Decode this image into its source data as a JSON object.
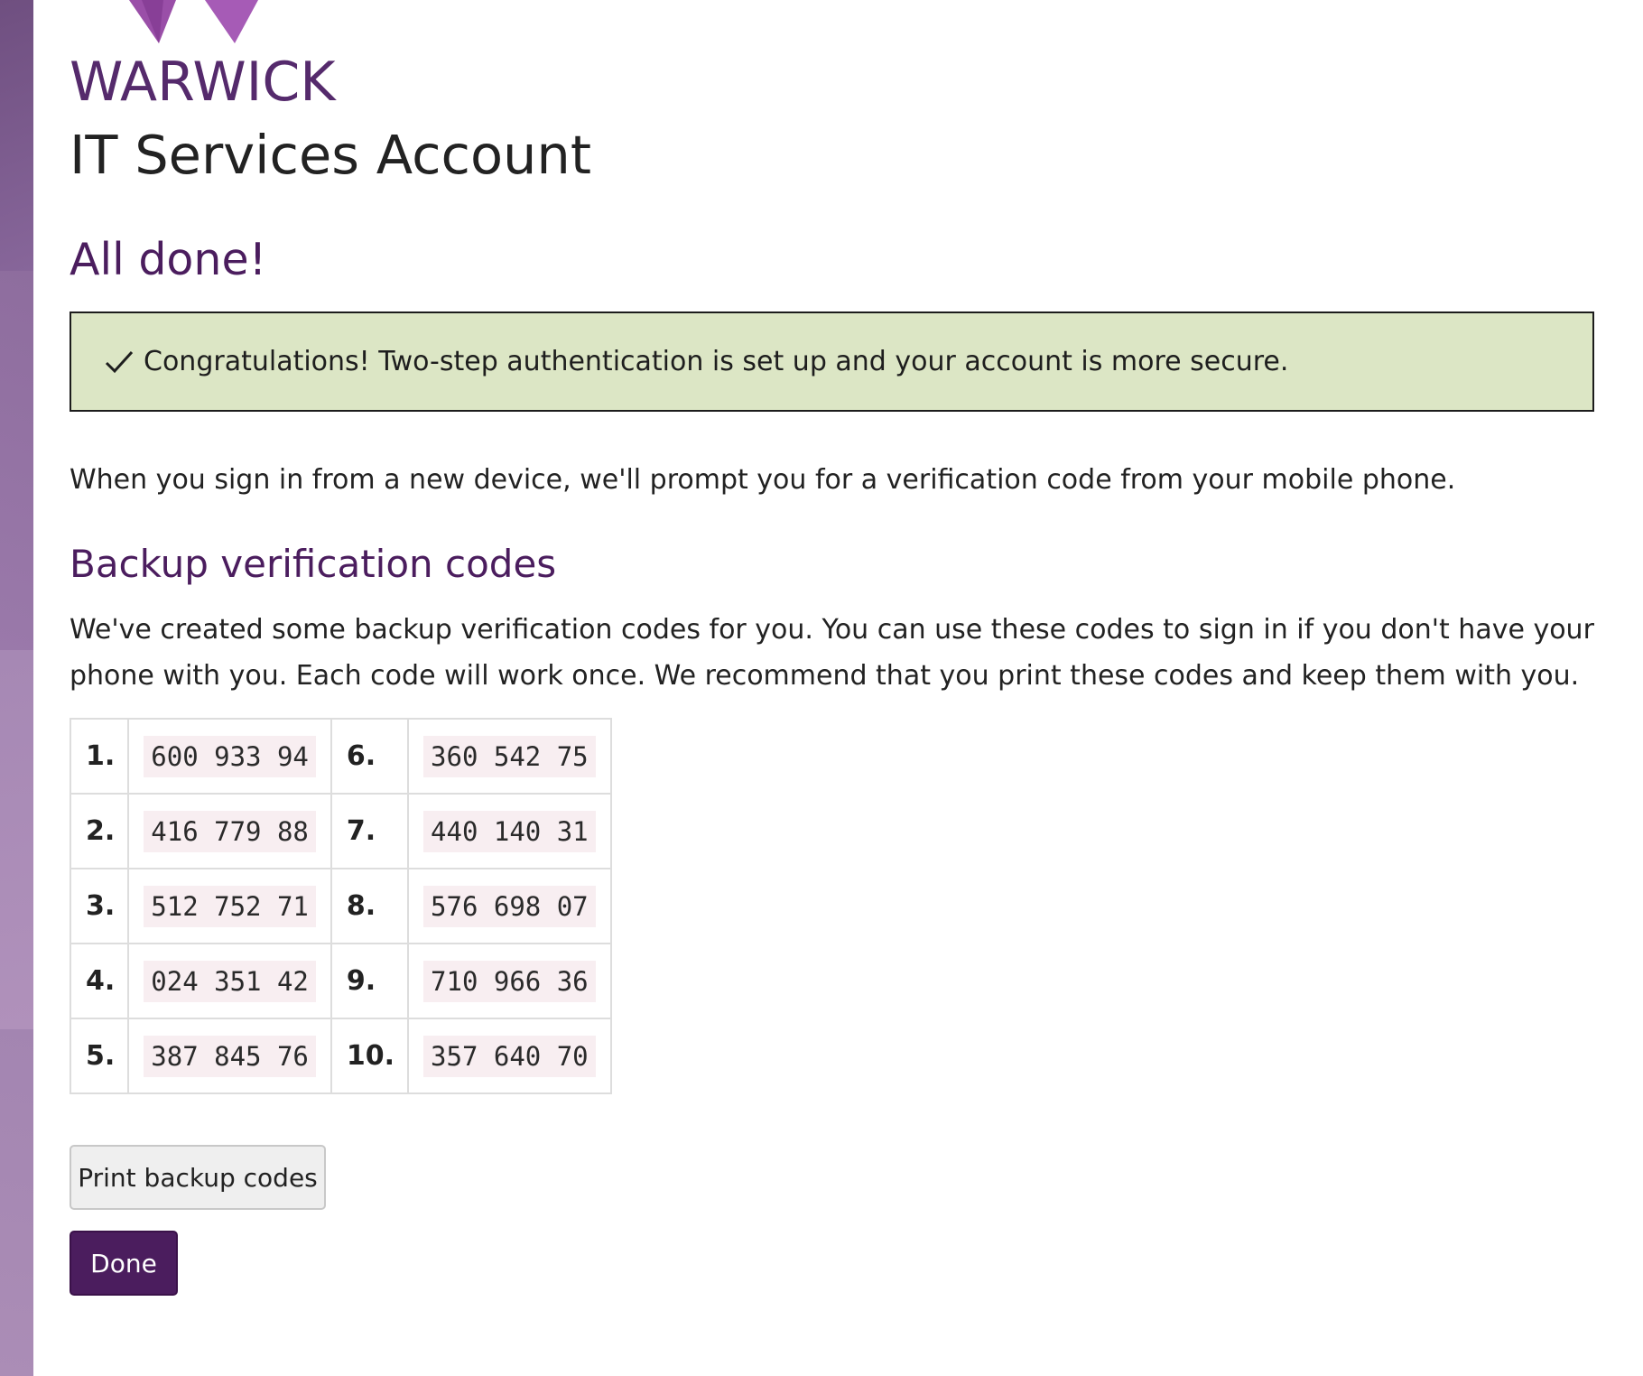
{
  "logo": {
    "wordmark": "WARWICK"
  },
  "page": {
    "app_title": "IT Services Account"
  },
  "main": {
    "heading": "All done!",
    "alert": {
      "icon": "check-icon",
      "message": "Congratulations! Two-step authentication is set up and your account is more secure."
    },
    "intro": "When you sign in from a new device, we'll prompt you for a verification code from your mobile phone.",
    "backup_heading": "Backup verification codes",
    "backup_description": "We've created some backup verification codes for you. You can use these codes to sign in if you don't have your phone with you. Each code will work once. We recommend that you print these codes and keep them with you.",
    "codes": [
      {
        "left_num": "1.",
        "left_code": "600 933 94",
        "right_num": "6.",
        "right_code": "360 542 75"
      },
      {
        "left_num": "2.",
        "left_code": "416 779 88",
        "right_num": "7.",
        "right_code": "440 140 31"
      },
      {
        "left_num": "3.",
        "left_code": "512 752 71",
        "right_num": "8.",
        "right_code": "576 698 07"
      },
      {
        "left_num": "4.",
        "left_code": "024 351 42",
        "right_num": "9.",
        "right_code": "710 966 36"
      },
      {
        "left_num": "5.",
        "left_code": "387 845 76",
        "right_num": "10.",
        "right_code": "357 640 70"
      }
    ],
    "print_button": "Print backup codes",
    "done_button": "Done"
  },
  "colors": {
    "brand_purple": "#552a6c",
    "heading_purple": "#4b1d5e",
    "success_bg": "#dce6c5",
    "code_bg": "#f8eef1"
  }
}
